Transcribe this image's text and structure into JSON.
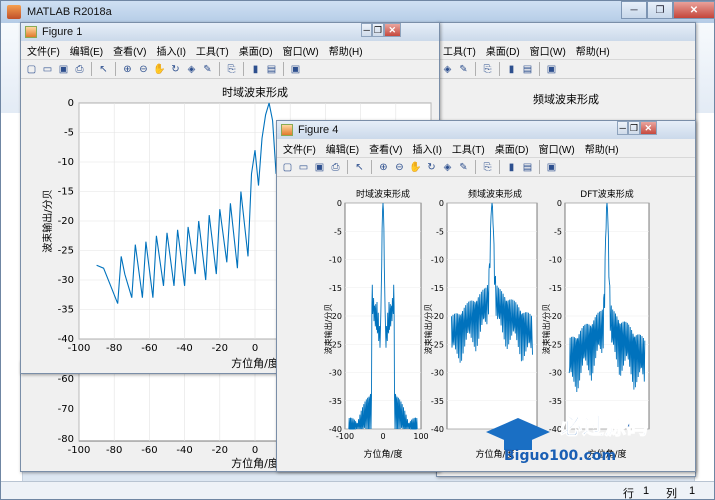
{
  "main_window": {
    "title": "MATLAB R2018a",
    "status_row": "行",
    "status_row_value": "1",
    "status_col": "列",
    "status_col_value": "1"
  },
  "figure1": {
    "title": "Figure 1",
    "menus": [
      "文件(F)",
      "编辑(E)",
      "查看(V)",
      "插入(I)",
      "工具(T)",
      "桌面(D)",
      "窗口(W)",
      "帮助(H)"
    ],
    "chart_title": "时域波束形成",
    "xlabel": "方位角/度",
    "ylabel": "波束输出/分贝"
  },
  "figure2_hidden": {
    "menus": [
      "工具(T)",
      "桌面(D)",
      "窗口(W)",
      "帮助(H)"
    ],
    "chart_title": "频域波束形成",
    "xlabel": "方位角/度"
  },
  "figure4": {
    "title": "Figure 4",
    "menus": [
      "文件(F)",
      "编辑(E)",
      "查看(V)",
      "插入(I)",
      "工具(T)",
      "桌面(D)",
      "窗口(W)",
      "帮助(H)"
    ],
    "sub_titles": [
      "时域波束形成",
      "频域波束形成",
      "DFT波束形成"
    ],
    "xlabel": "方位角/度",
    "ylabel": "波束输出/分贝"
  },
  "watermark": {
    "text": "必过源码",
    "url": "Biguo100.com"
  },
  "icons": [
    "new-file-icon",
    "open-folder-icon",
    "save-icon",
    "print-icon",
    "pointer-icon",
    "zoom-in-icon",
    "zoom-out-icon",
    "pan-icon",
    "rotate-icon",
    "data-cursor-icon",
    "brush-icon",
    "link-icon",
    "colorbar-icon",
    "legend-icon",
    "plot-tools-icon"
  ],
  "chart_data": [
    {
      "type": "line",
      "title": "时域波束形成",
      "xlabel": "方位角/度",
      "ylabel": "波束输出/分贝",
      "xlim": [
        -100,
        100
      ],
      "ylim": [
        -40,
        0
      ],
      "xticks": [
        -100,
        -80,
        -60,
        -40,
        -20,
        0,
        20,
        40,
        60,
        80,
        100
      ],
      "yticks": [
        0,
        -5,
        -10,
        -15,
        -20,
        -25,
        -30,
        -35,
        -40
      ],
      "color": "#0072bd",
      "grid": true,
      "x": [
        -90,
        -86,
        -82,
        -78,
        -76,
        -74,
        -70,
        -68,
        -64,
        -62,
        -58,
        -56,
        -52,
        -50,
        -46,
        -44,
        -40,
        -38,
        -34,
        -32,
        -28,
        -26,
        -22,
        -20,
        -16,
        -14,
        -10,
        -8,
        -4,
        -2,
        0,
        2,
        4,
        6,
        8,
        10,
        12,
        14,
        16,
        18,
        20,
        22,
        24,
        26,
        28,
        30,
        32,
        34,
        36,
        38,
        40,
        42
      ],
      "y": [
        -27.5,
        -28,
        -31,
        -34,
        -26,
        -29,
        -33,
        -24,
        -33,
        -23.5,
        -33,
        -22.5,
        -31,
        -22,
        -31,
        -21.5,
        -31,
        -21,
        -29,
        -20,
        -30,
        -19,
        -29,
        -18,
        -27,
        -17,
        -28,
        -15,
        -26,
        -12,
        -8,
        -14,
        -6,
        -2,
        0,
        -3,
        -12,
        -8,
        -20,
        -12,
        -25,
        -14,
        -30,
        -13,
        -33,
        -16,
        -30,
        -18,
        -36,
        -20,
        -35,
        -22
      ]
    },
    {
      "type": "line",
      "title": "时域波束形成",
      "xlim": [
        -100,
        100
      ],
      "ylim": [
        -40,
        0
      ],
      "xticks": [
        -100,
        0,
        100
      ],
      "yticks": [
        0,
        -5,
        -10,
        -15,
        -20,
        -25,
        -30,
        -35,
        -40
      ],
      "color": "#0072bd"
    },
    {
      "type": "line",
      "title": "频域波束形成",
      "xlim": [
        -100,
        100
      ],
      "ylim": [
        -40,
        0
      ],
      "yticks": [
        0,
        -5,
        -10,
        -15,
        -20,
        -25,
        -30,
        -35,
        -40
      ],
      "color": "#0072bd"
    },
    {
      "type": "line",
      "title": "DFT波束形成",
      "xlim": [
        -100,
        100
      ],
      "ylim": [
        -40,
        0
      ],
      "yticks": [
        0,
        -5,
        -10,
        -15,
        -20,
        -25,
        -30,
        -35,
        -40
      ],
      "color": "#0072bd"
    }
  ]
}
